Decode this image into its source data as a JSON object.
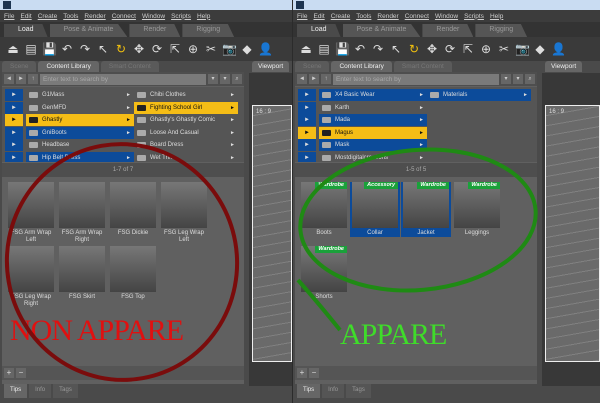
{
  "colors": {
    "selection": "#0c4b9a",
    "highlight": "#f5bd16",
    "badge": "#1aa13a",
    "red_annotation": "#e01010",
    "green_annotation": "#3fdc2a"
  },
  "panels": [
    {
      "menu": [
        "File",
        "Edit",
        "Create",
        "Tools",
        "Render",
        "Connect",
        "Window",
        "Scripts",
        "Help"
      ],
      "tabs": [
        "Load",
        "Pose & Animate",
        "Render",
        "Rigging"
      ],
      "panel_tabs": [
        "Scene",
        "Content Library",
        "Smart Content"
      ],
      "viewport_tab": "Viewport",
      "aspect": "16 : 9",
      "search_placeholder": "Enter text to search by",
      "tree_col1": [
        {
          "label": "G1Mass",
          "state": ""
        },
        {
          "label": "GenMFD",
          "state": ""
        },
        {
          "label": "Ghastly",
          "state": "hi"
        },
        {
          "label": "GniBoots",
          "state": "sel"
        },
        {
          "label": "Headbase",
          "state": ""
        },
        {
          "label": "Hip Belt Dress",
          "state": "sel"
        }
      ],
      "tree_col2": [
        {
          "label": "Chibi Clothes",
          "state": ""
        },
        {
          "label": "Fighting School Girl",
          "state": "hi"
        },
        {
          "label": "Ghastly's Ghastly Comic",
          "state": ""
        },
        {
          "label": "Loose And Casual",
          "state": ""
        },
        {
          "label": "Board Dress",
          "state": ""
        },
        {
          "label": "Wet Thi...",
          "state": ""
        }
      ],
      "page_info": "1-7 of 7",
      "items": [
        {
          "label": "FSG Arm Wrap Left"
        },
        {
          "label": "FSG Arm Wrap Right"
        },
        {
          "label": "FSG Dickie"
        },
        {
          "label": "FSG Leg Wrap Left"
        },
        {
          "label": "FSG Leg Wrap Right"
        },
        {
          "label": "FSG Skirt"
        },
        {
          "label": "FSG Top"
        }
      ],
      "bottom_tabs": [
        "Tips",
        "Info",
        "Tags"
      ],
      "annotation": "NON APPARE"
    },
    {
      "menu": [
        "File",
        "Edit",
        "Create",
        "Tools",
        "Render",
        "Connect",
        "Window",
        "Scripts",
        "Help"
      ],
      "tabs": [
        "Load",
        "Pose & Animate",
        "Render",
        "Rigging"
      ],
      "panel_tabs": [
        "Scene",
        "Content Library",
        "Smart Content"
      ],
      "viewport_tab": "Viewport",
      "aspect": "16 : 9",
      "search_placeholder": "Enter text to search by",
      "tree_col1": [
        {
          "label": "X4 Basic Wear",
          "state": "sel"
        },
        {
          "label": "Karth",
          "state": ""
        },
        {
          "label": "Mada",
          "state": "sel"
        },
        {
          "label": "Magus",
          "state": "hi"
        },
        {
          "label": "Mask",
          "state": "sel"
        },
        {
          "label": "Mostdigitalcreations",
          "state": ""
        }
      ],
      "tree_col2": [
        {
          "label": "Materials",
          "state": "sel"
        }
      ],
      "page_info": "1-5 of 5",
      "items": [
        {
          "label": "Boots",
          "badge": "Wardrobe"
        },
        {
          "label": "Collar",
          "badge": "Accessory",
          "selected": true
        },
        {
          "label": "Jacket",
          "badge": "Wardrobe",
          "selected": true
        },
        {
          "label": "Leggings",
          "badge": "Wardrobe"
        },
        {
          "label": "Shorts",
          "badge": "Wardrobe"
        }
      ],
      "bottom_tabs": [
        "Tips",
        "Info",
        "Tags"
      ],
      "annotation": "APPARE"
    }
  ]
}
